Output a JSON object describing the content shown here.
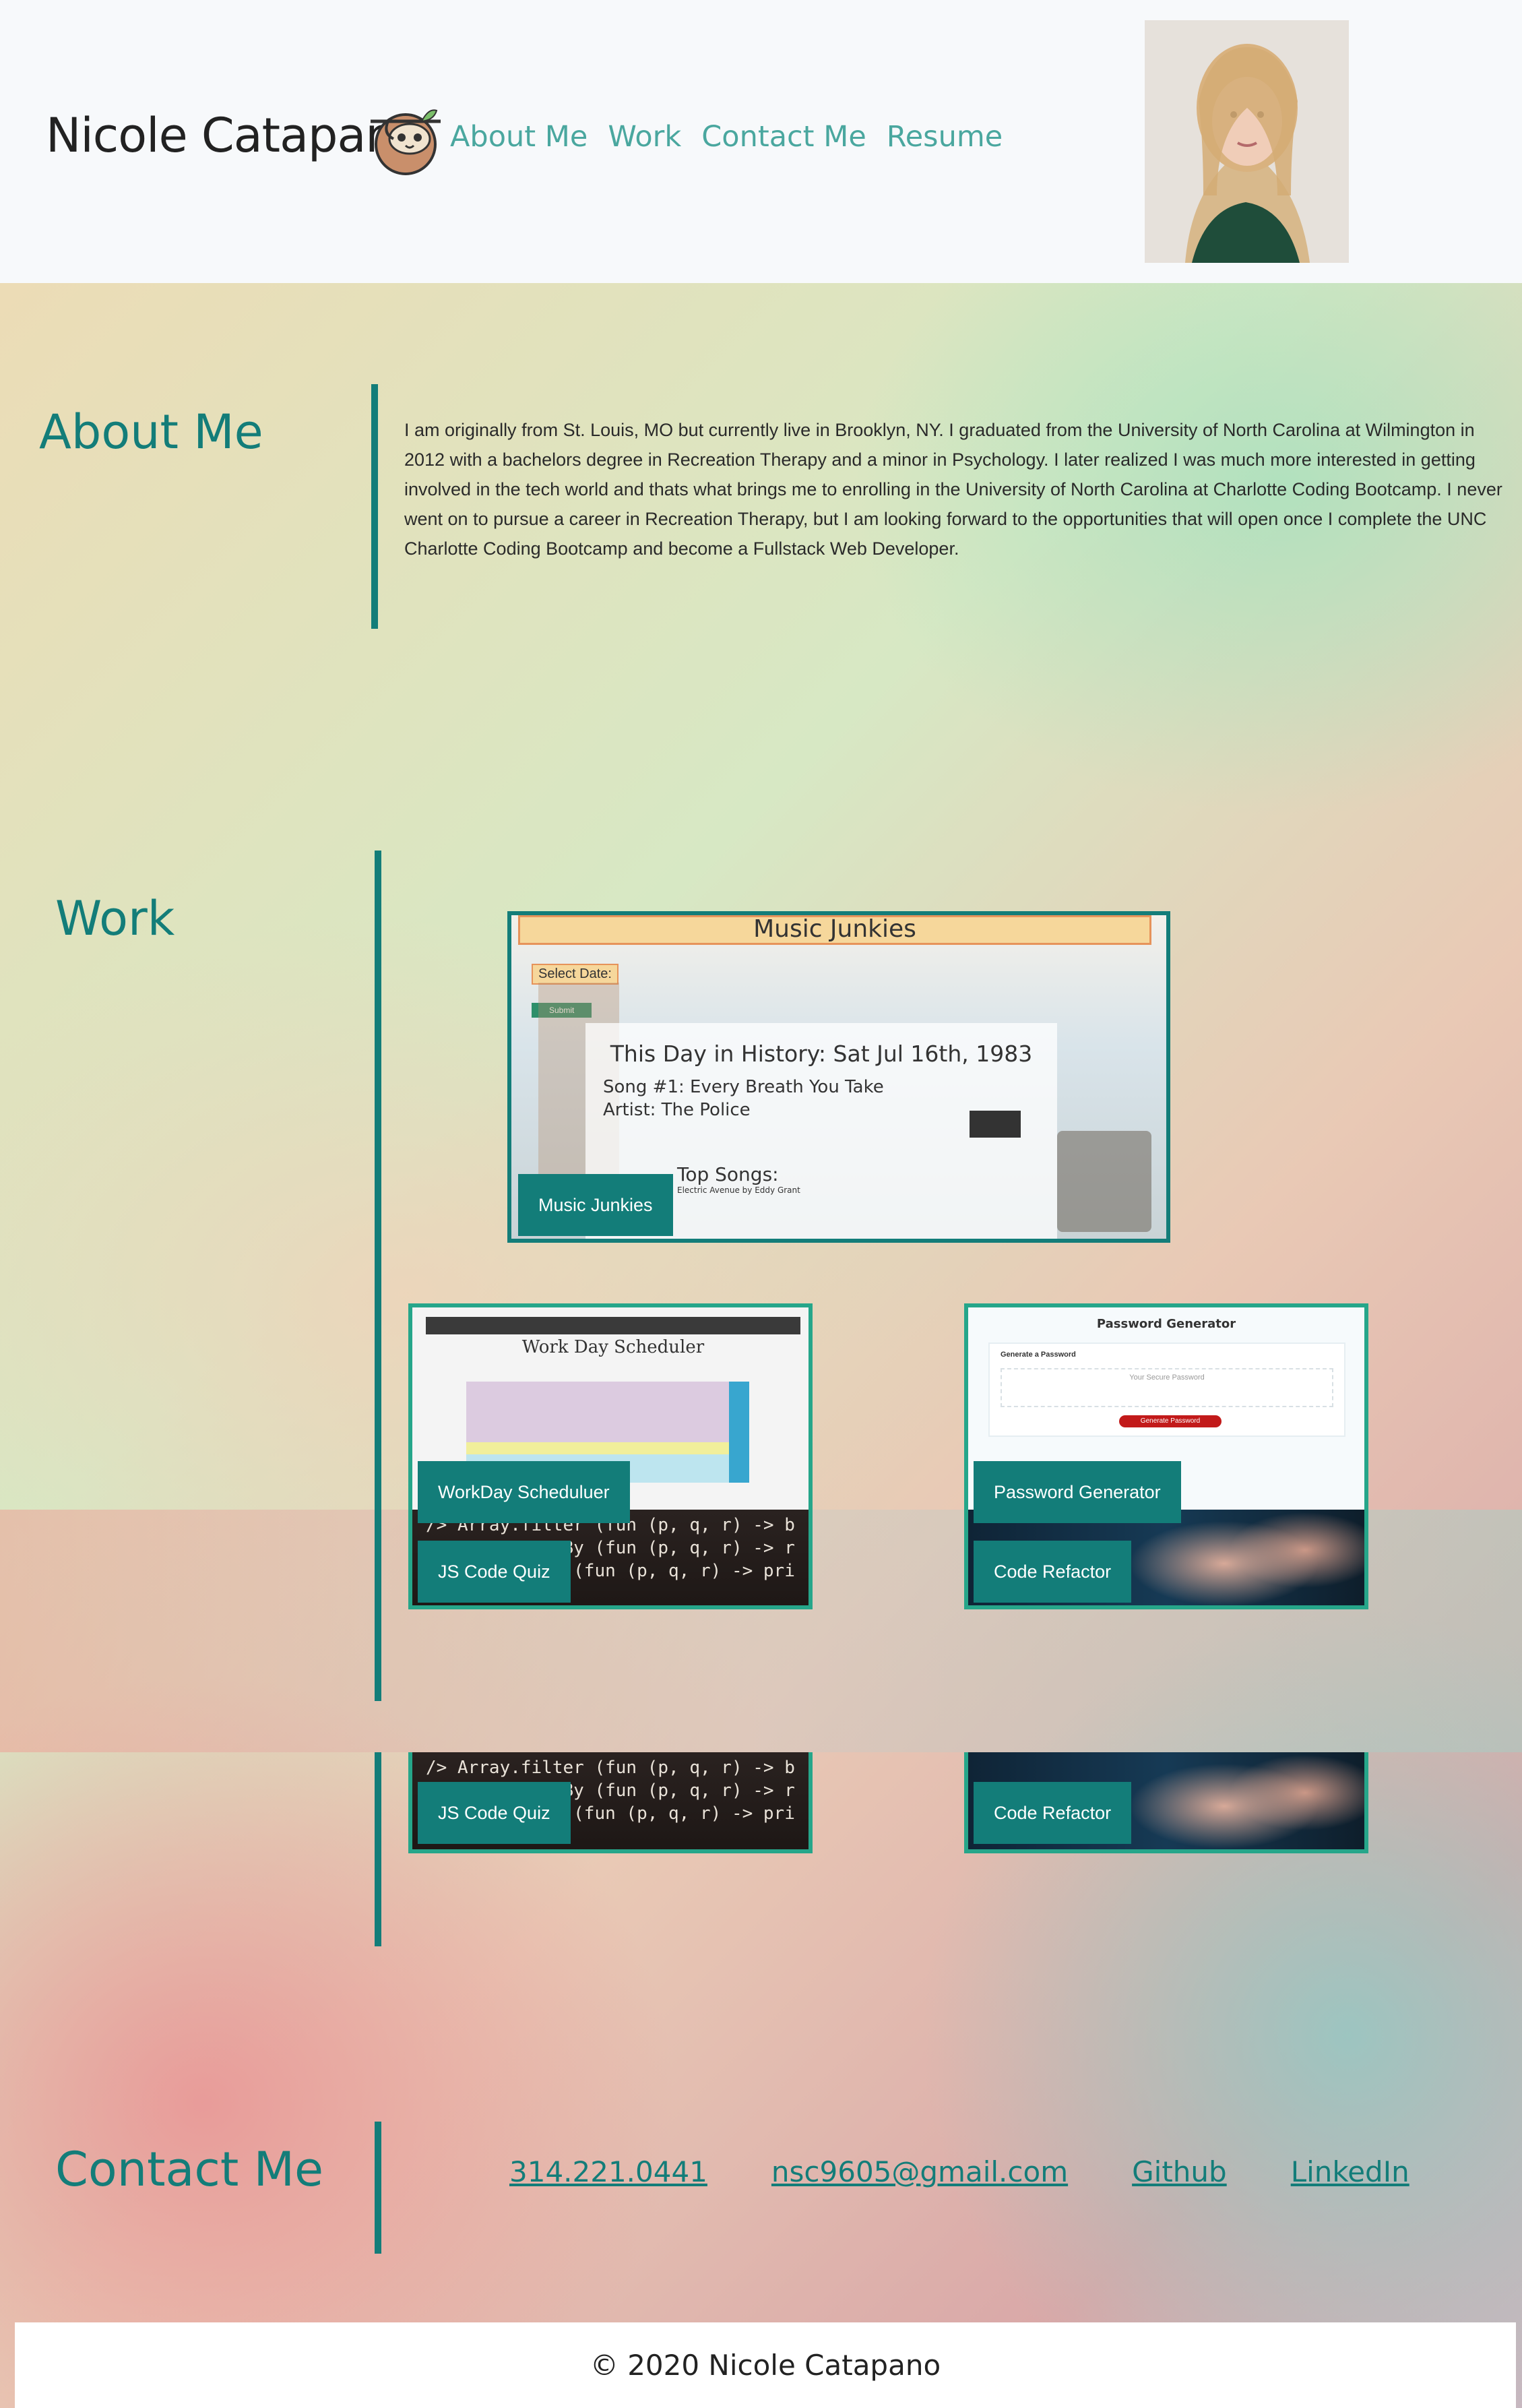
{
  "header": {
    "name": "Nicole Catapano",
    "nav": [
      "About Me",
      "Work",
      "Contact Me",
      "Resume"
    ]
  },
  "about": {
    "title": "About Me",
    "text": "I am originally from St. Louis, MO but currently live in Brooklyn, NY. I graduated from the University of North Carolina at Wilmington in 2012 with a bachelors degree in Recreation Therapy and a minor in Psychology. I later realized I was much more interested in getting involved in the tech world and thats what brings me to enrolling in the University of North Carolina at Charlotte Coding Bootcamp. I never went on to pursue a career in Recreation Therapy, but I am looking forward to the opportunities that will open once I complete the UNC Charlotte Coding Bootcamp and become a Fullstack Web Developer."
  },
  "work": {
    "title": "Work",
    "projects": [
      {
        "label": "Music Junkies",
        "thumb": {
          "header": "Music Junkies",
          "select_date": "Select Date:",
          "button": "Submit",
          "history_title": "This Day in History: Sat Jul 16th, 1983",
          "song": "Song #1: Every Breath You Take",
          "artist": "Artist: The Police",
          "top_songs": "Top Songs:",
          "footer": "Electric Avenue by Eddy Grant"
        }
      },
      {
        "label": "WorkDay Scheduluer",
        "thumb": {
          "title": "Work Day Scheduler"
        }
      },
      {
        "label": "Password Generator",
        "thumb": {
          "title": "Password Generator",
          "subtitle": "Generate a Password",
          "placeholder": "Your Secure Password",
          "button": "Generate Password"
        }
      },
      {
        "label": "JS Code Quiz"
      },
      {
        "label": "Code Refactor"
      }
    ],
    "code_lines": [
      "/> Array.filter (fun (p, q, r) -> b",
      "/> Array.sortBy (fun (p, q, r) -> r",
      "    |> filter (fun (p, q, r) -> pri"
    ]
  },
  "contact": {
    "title": "Contact Me",
    "phone": "314.221.0441",
    "email": "nsc9605@gmail.com",
    "github": "Github",
    "linkedin": "LinkedIn"
  },
  "footer": {
    "text": "© 2020 Nicole Catapano"
  },
  "colors": {
    "accent": "#137d79",
    "nav": "#4aa79f",
    "card_border_alt": "#26a68a"
  }
}
